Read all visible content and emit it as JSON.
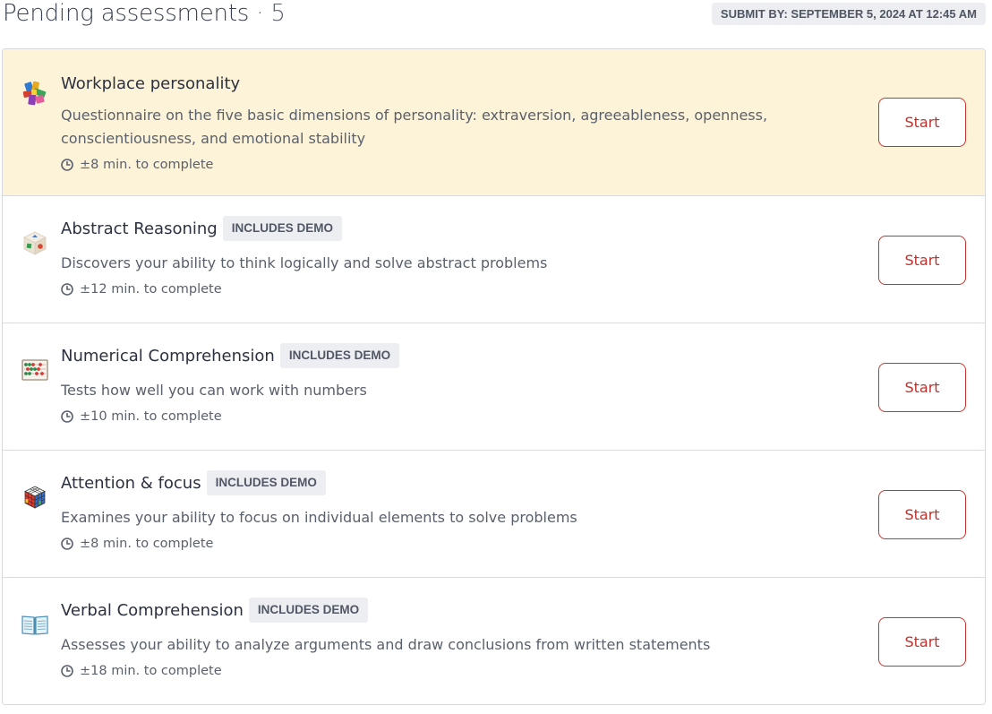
{
  "header": {
    "title": "Pending assessments",
    "separator": "·",
    "count": "5",
    "deadline": "SUBMIT BY: SEPTEMBER 5, 2024 AT 12:45 AM"
  },
  "colors": {
    "accent": "#c0312b",
    "highlight_bg": "#fdf3d8",
    "badge_bg": "#eceef1"
  },
  "assessments": [
    {
      "title": "Workplace personality",
      "badge": "",
      "description": "Questionnaire on the five basic dimensions of personality: extraversion, agreeableness, openness, conscientiousness, and emotional stability",
      "duration": "±8 min. to complete",
      "button": "Start",
      "icon": "puzzle-blocks-icon"
    },
    {
      "title": "Abstract Reasoning",
      "badge": "INCLUDES DEMO",
      "description": "Discovers your ability to think logically and solve abstract problems",
      "duration": "±12 min. to complete",
      "button": "Start",
      "icon": "shape-cube-icon"
    },
    {
      "title": "Numerical Comprehension",
      "badge": "INCLUDES DEMO",
      "description": "Tests how well you can work with numbers",
      "duration": "±10 min. to complete",
      "button": "Start",
      "icon": "abacus-icon"
    },
    {
      "title": "Attention & focus",
      "badge": "INCLUDES DEMO",
      "description": "Examines your ability to focus on individual elements to solve problems",
      "duration": "±8 min. to complete",
      "button": "Start",
      "icon": "rubiks-cube-icon"
    },
    {
      "title": "Verbal Comprehension",
      "badge": "INCLUDES DEMO",
      "description": "Assesses your ability to analyze arguments and draw conclusions from written statements",
      "duration": "±18 min. to complete",
      "button": "Start",
      "icon": "open-book-icon"
    }
  ]
}
